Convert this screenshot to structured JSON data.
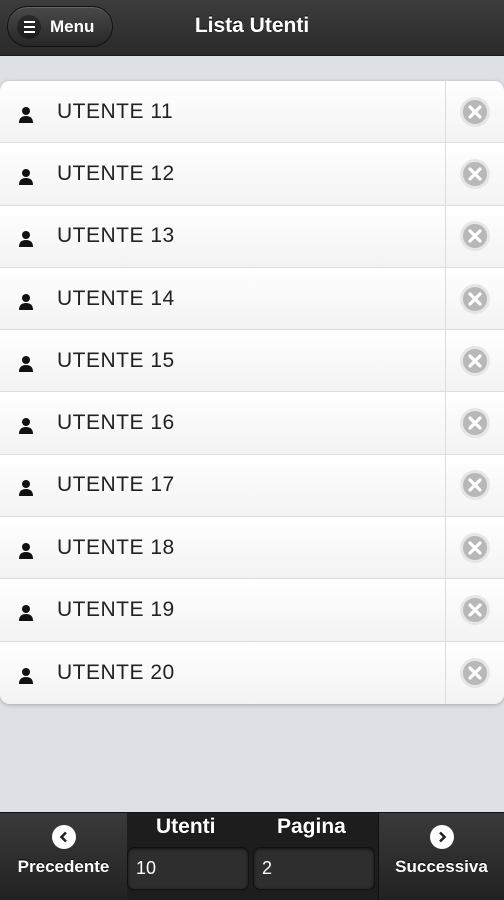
{
  "header": {
    "menu_label": "Menu",
    "title": "Lista Utenti"
  },
  "users": [
    {
      "label": "UTENTE 11"
    },
    {
      "label": "UTENTE 12"
    },
    {
      "label": "UTENTE 13"
    },
    {
      "label": "UTENTE 14"
    },
    {
      "label": "UTENTE 15"
    },
    {
      "label": "UTENTE 16"
    },
    {
      "label": "UTENTE 17"
    },
    {
      "label": "UTENTE 18"
    },
    {
      "label": "UTENTE 19"
    },
    {
      "label": "UTENTE 20"
    }
  ],
  "icons": {
    "row_icon": "user-icon",
    "row_action_icon": "delete-circle-icon",
    "menu_icon": "hamburger-icon",
    "prev_icon": "chevron-left-icon",
    "next_icon": "chevron-right-icon"
  },
  "footer": {
    "prev_label": "Precedente",
    "next_label": "Successiva",
    "utenti_label": "Utenti",
    "utenti_value": "10",
    "pagina_label": "Pagina",
    "pagina_value": "2"
  },
  "colors": {
    "header_bg": "#2f2f2f",
    "page_bg": "#dde0e4",
    "row_bg": "#fafafa",
    "delete_icon": "#b8b8b8"
  }
}
